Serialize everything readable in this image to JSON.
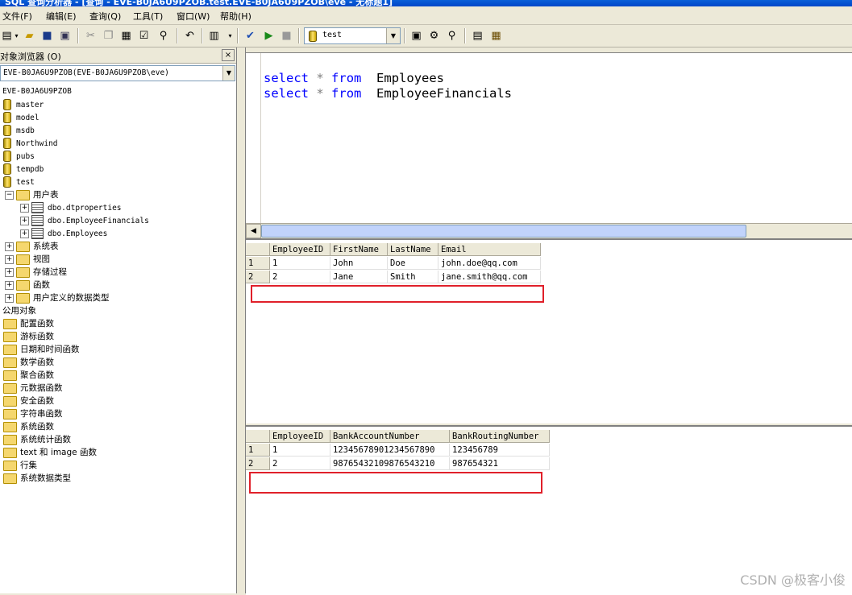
{
  "window": {
    "title": "SQL 查询分析器 - [查询 - EVE-B0JA6U9PZOB.test.EVE-B0JA6U9PZOB\\eve - 无标题1]"
  },
  "menu": [
    "文件(F)",
    "编辑(E)",
    "查询(Q)",
    "工具(T)",
    "窗口(W)",
    "帮助(H)"
  ],
  "toolbar": {
    "database": "test"
  },
  "object_browser": {
    "title": "对象浏览器 (O)",
    "close_icon": "×",
    "server_selector": "EVE-B0JA6U9PZOB(EVE-B0JA6U9PZOB\\eve)",
    "server": "EVE-B0JA6U9PZOB",
    "databases": [
      "master",
      "model",
      "msdb",
      "Northwind",
      "pubs",
      "tempdb",
      "test"
    ],
    "user_tables_folder": "用户表",
    "user_tables": [
      "dbo.dtproperties",
      "dbo.EmployeeFinancials",
      "dbo.Employees"
    ],
    "db_folders": [
      "系统表",
      "视图",
      "存储过程",
      "函数",
      "用户定义的数据类型"
    ],
    "common_objects_label": "公用对象",
    "common_objects": [
      "配置函数",
      "游标函数",
      "日期和时间函数",
      "数学函数",
      "聚合函数",
      "元数据函数",
      "安全函数",
      "字符串函数",
      "系统函数",
      "系统统计函数",
      "text 和 image 函数",
      "行集",
      "系统数据类型"
    ]
  },
  "editor": {
    "lines": [
      {
        "kw1": "select",
        "op": "*",
        "kw2": "from",
        "obj": "Employees"
      },
      {
        "kw1": "select",
        "op": "*",
        "kw2": "from",
        "obj": "EmployeeFinancials"
      }
    ]
  },
  "results": [
    {
      "columns": [
        "EmployeeID",
        "FirstName",
        "LastName",
        "Email"
      ],
      "rows": [
        {
          "n": "1",
          "cells": [
            "1",
            "John",
            "Doe",
            "john.doe@qq.com"
          ]
        },
        {
          "n": "2",
          "cells": [
            "2",
            "Jane",
            "Smith",
            "jane.smith@qq.com"
          ]
        }
      ]
    },
    {
      "columns": [
        "EmployeeID",
        "BankAccountNumber",
        "BankRoutingNumber"
      ],
      "rows": [
        {
          "n": "1",
          "cells": [
            "1",
            "12345678901234567890",
            "123456789"
          ]
        },
        {
          "n": "2",
          "cells": [
            "2",
            "98765432109876543210",
            "987654321"
          ]
        }
      ]
    }
  ],
  "watermark": "CSDN @极客小俊",
  "colors": {
    "keyword": "#0000ff",
    "highlight": "#e0202a",
    "titlebar": "#0a5fd8"
  },
  "icons": [
    "new-query-icon",
    "open-icon",
    "save-icon",
    "cut-icon",
    "copy-icon",
    "paste-icon",
    "find-icon",
    "undo-icon",
    "grid-mode-icon",
    "parse-check-icon",
    "execute-icon",
    "stop-icon",
    "database-icon",
    "object-browser-icon",
    "close-icon",
    "folder-icon",
    "table-icon"
  ]
}
